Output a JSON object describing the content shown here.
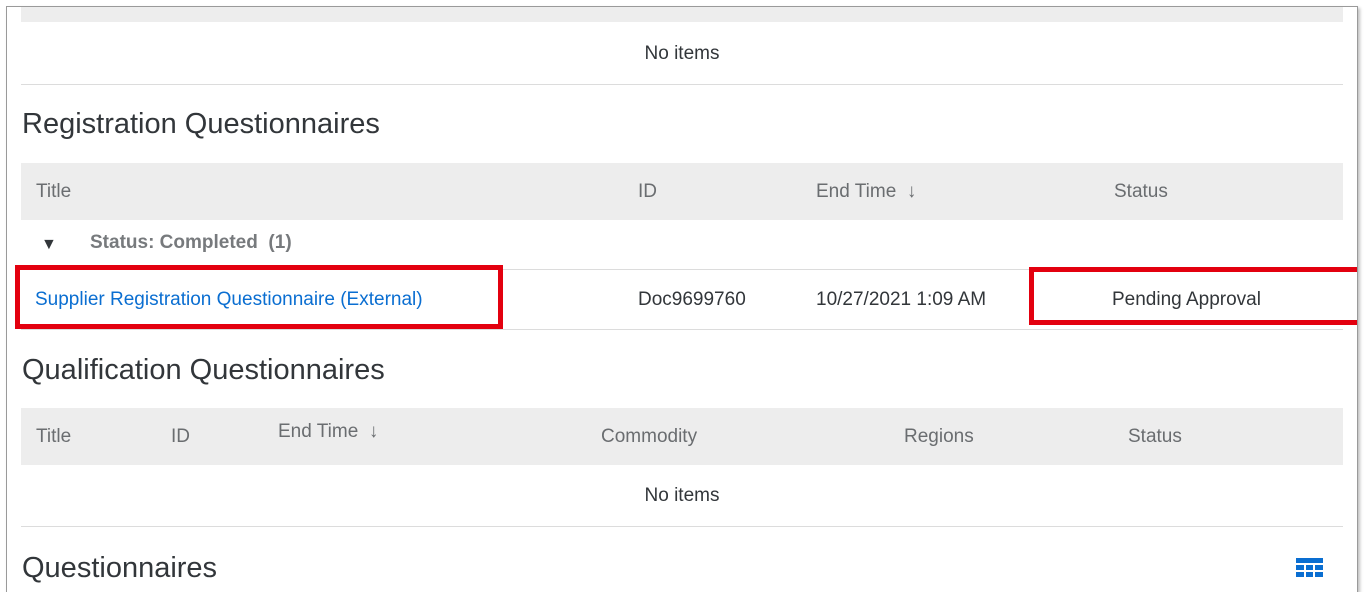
{
  "top_table": {
    "empty_text": "No items"
  },
  "registration": {
    "title": "Registration Questionnaires",
    "columns": {
      "title": "Title",
      "id": "ID",
      "end_time": "End Time",
      "sort_icon": "↓",
      "status": "Status"
    },
    "group": {
      "label": "Status: Completed",
      "count": "(1)",
      "icon": "triangle-down-icon"
    },
    "rows": [
      {
        "title": "Supplier Registration Questionnaire (External)",
        "id": "Doc9699760",
        "end_time": "10/27/2021 1:09 AM",
        "status": "Pending Approval"
      }
    ]
  },
  "qualification": {
    "title": "Qualification Questionnaires",
    "columns": {
      "title": "Title",
      "id": "ID",
      "end_time": "End Time",
      "sort_icon": "↓",
      "commodity": "Commodity",
      "regions": "Regions",
      "status": "Status"
    },
    "empty_text": "No items"
  },
  "questionnaires": {
    "title": "Questionnaires",
    "icon": "table-settings-icon"
  },
  "colors": {
    "link": "#0a6ed1",
    "highlight_box": "#e3000f",
    "header_bg": "#ededed"
  }
}
